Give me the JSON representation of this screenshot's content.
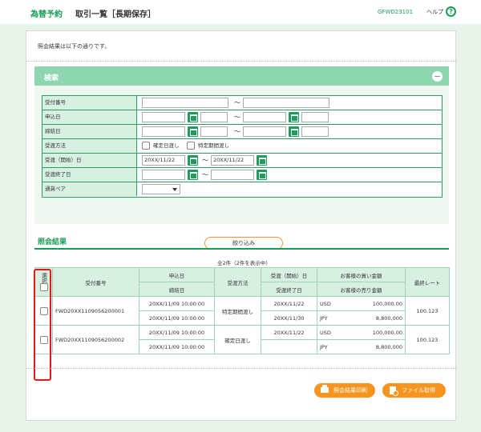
{
  "header": {
    "app_title": "為替予約",
    "page_title": "取引一覧［長期保存］",
    "screen_id": "GFWD23101",
    "help_label": "ヘルプ",
    "help_icon": "?"
  },
  "intro_text": "照会結果は以下の通りです。",
  "search": {
    "title": "検索",
    "tilde": "～",
    "fields": {
      "receipt_no": "受付番号",
      "apply_date": "申込日",
      "contract_date": "締結日",
      "delivery_method": "受渡方法",
      "delivery_start": "受渡（開始）日",
      "delivery_end": "受渡終了日",
      "currency_pair": "通貨ペア"
    },
    "delivery_options": [
      "確定日渡し",
      "特定期間渡し"
    ],
    "delivery_start_from": "20XX/11/22",
    "delivery_start_to": "20XX/11/22",
    "narrow_button": "絞り込み"
  },
  "results": {
    "title": "照会結果",
    "count_text": "全2件（2件を表示中）",
    "headers": {
      "select": "選択",
      "receipt_no": "受付番号",
      "apply_date": "申込日",
      "contract_date": "締結日",
      "delivery_method": "受渡方法",
      "delivery_start": "受渡（開始）日",
      "delivery_end": "受渡終了日",
      "buy_amount": "お客様の買い金額",
      "sell_amount": "お客様の売り金額",
      "rate": "最終レート"
    },
    "rows": [
      {
        "receipt_no": "FWD20XX1109056200001",
        "apply_date": "20XX/11/09 10:00:00",
        "contract_date": "20XX/11/09 10:00:00",
        "delivery_method": "特定期間渡し",
        "delivery_start": "20XX/11/22",
        "delivery_end": "20XX/11/30",
        "buy_currency": "USD",
        "buy_amount": "100,000.00",
        "sell_currency": "JPY",
        "sell_amount": "8,800,000",
        "rate": "100.123"
      },
      {
        "receipt_no": "FWD20XX1109056200002",
        "apply_date": "20XX/11/09 10:00:00",
        "contract_date": "20XX/11/09 10:00:00",
        "delivery_method": "確定日渡し",
        "delivery_start": "20XX/11/22",
        "delivery_end": "",
        "buy_currency": "USD",
        "buy_amount": "100,000.00",
        "sell_currency": "JPY",
        "sell_amount": "8,800,000",
        "rate": "100.123"
      }
    ]
  },
  "buttons": {
    "print": "照会結果印刷",
    "file": "ファイル取得"
  },
  "colors": {
    "brand_green": "#179c55",
    "panel_header": "#8ed6b0",
    "accent_orange": "#f7941d",
    "highlight_red": "#e21a1a"
  }
}
